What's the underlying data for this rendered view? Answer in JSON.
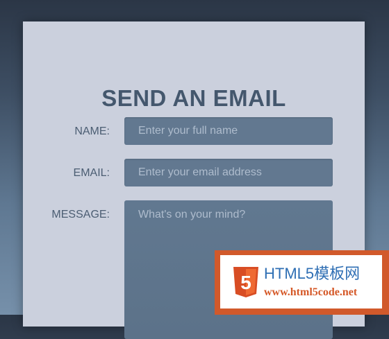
{
  "form": {
    "title": "SEND AN EMAIL",
    "name_label": "NAME:",
    "name_placeholder": "Enter your full name",
    "email_label": "EMAIL:",
    "email_placeholder": "Enter your email address",
    "message_label": "MESSAGE:",
    "message_placeholder": "What's on your mind?"
  },
  "watermark": {
    "title": "HTML5模板网",
    "url": "www.html5code.net",
    "logo_text": "5",
    "colors": {
      "frame": "#d1592b",
      "title": "#2f6fb4",
      "url": "#d55827",
      "shield_dark": "#d84d24",
      "shield_light": "#ef6a33"
    }
  },
  "colors": {
    "card": "#cbd0dd",
    "heading": "#44576d",
    "field": "#627890"
  }
}
